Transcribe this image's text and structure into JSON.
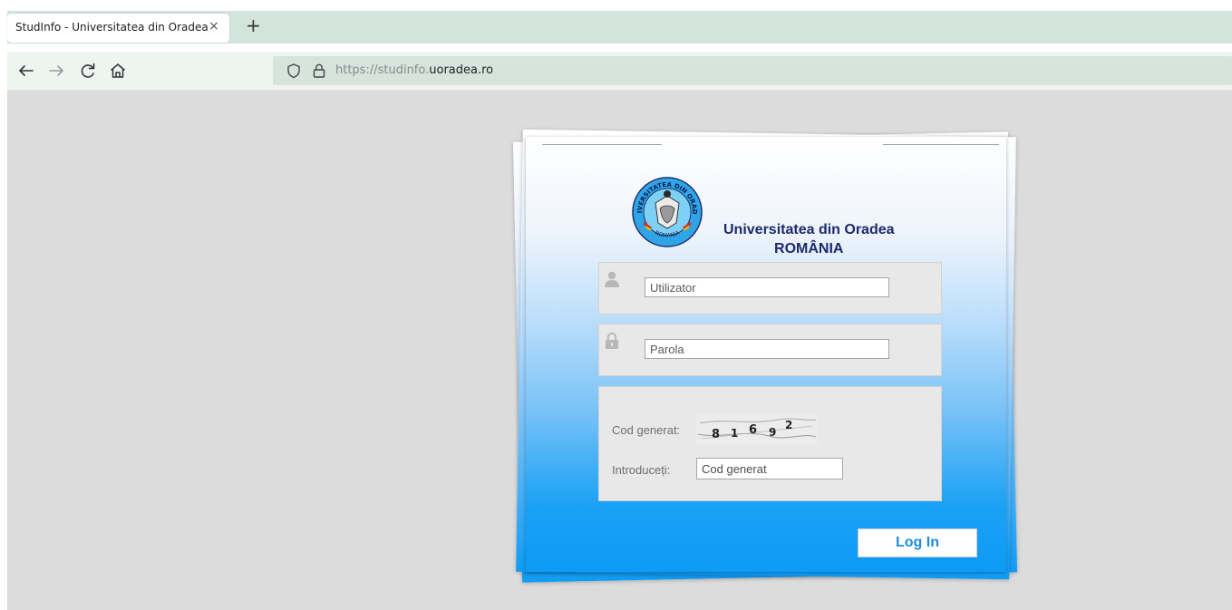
{
  "browser": {
    "tab": {
      "title": "StudInfo - Universitatea din Oradea",
      "close_glyph": "×"
    },
    "new_tab_glyph": "+",
    "nav": {
      "back_icon": "arrow-left-icon",
      "forward_icon": "arrow-right-icon",
      "reload_icon": "reload-icon",
      "home_icon": "home-icon"
    },
    "url": {
      "prefix": "https://studinfo.",
      "host": "uoradea.ro"
    }
  },
  "login": {
    "university_name": "Universitatea din Oradea",
    "country": "ROMÂNIA",
    "username_placeholder": "Utilizator",
    "password_placeholder": "Parola",
    "captcha_label": "Cod generat:",
    "captcha_code": [
      "8",
      "1",
      "6",
      "9",
      "2"
    ],
    "captcha_input_label": "Introduceți:",
    "captcha_placeholder": "Cod generat",
    "login_button": "Log In"
  },
  "seal": {
    "top_text": "UNIVERSITATEA DIN ORADEA",
    "bottom_text": "ROMANIA"
  },
  "colors": {
    "tabstrip": "#d3e4dc",
    "page_background": "#dcdcdc",
    "card_gradient_bottom": "#0e9bf5",
    "university_name": "#1d2a6b",
    "login_button_text": "#1f8be0"
  }
}
